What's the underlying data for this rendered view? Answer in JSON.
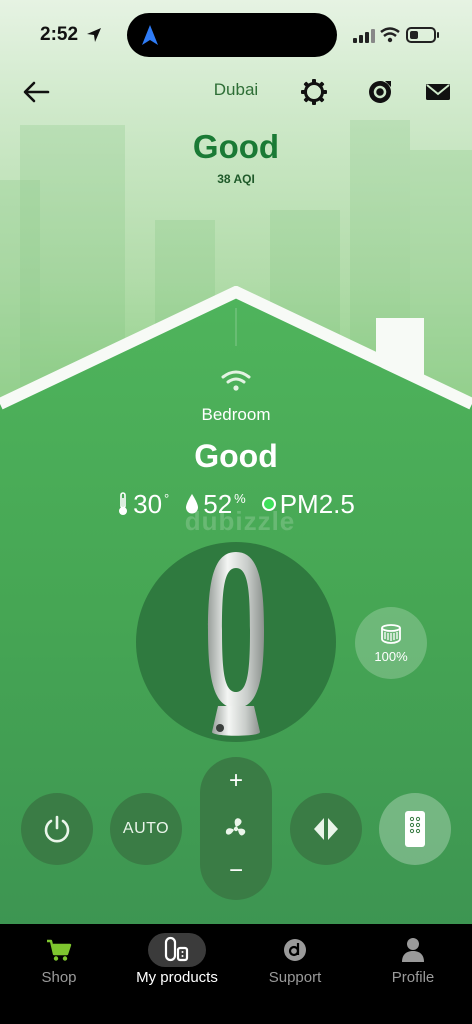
{
  "status_bar": {
    "time": "2:52"
  },
  "header": {
    "city": "Dubai"
  },
  "outdoor": {
    "status": "Good",
    "aqi_label": "38 AQI"
  },
  "room": {
    "name": "Bedroom",
    "status": "Good",
    "temperature": "30",
    "temperature_unit": "°",
    "humidity": "52",
    "humidity_unit": "%",
    "pollutant": "PM2.5",
    "pollutant_status_color": "#3ee05a"
  },
  "watermark": "dubizzle",
  "filter": {
    "life": "100%"
  },
  "controls": {
    "auto_label": "AUTO",
    "plus": "+",
    "minus": "−"
  },
  "tabs": [
    {
      "label": "Shop",
      "icon": "cart-icon"
    },
    {
      "label": "My products",
      "icon": "products-icon",
      "active": true
    },
    {
      "label": "Support",
      "icon": "support-icon"
    },
    {
      "label": "Profile",
      "icon": "profile-icon"
    }
  ],
  "colors": {
    "accent_green": "#1a7a35",
    "cart_green": "#7ec62f",
    "control_bg": "#3a7c45"
  }
}
